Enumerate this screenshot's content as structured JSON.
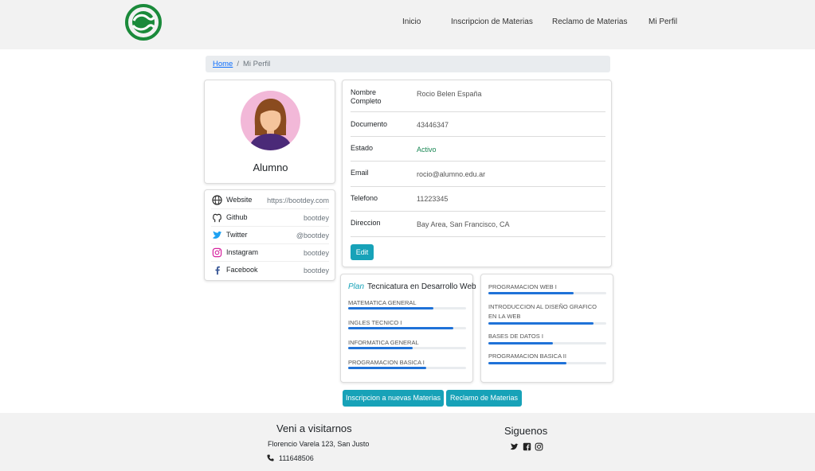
{
  "nav": {
    "logo_icon": "utn-logo-icon",
    "links": [
      "Inicio",
      "Inscripcion de Materias",
      "Reclamo de Materias",
      "Mi Perfil"
    ]
  },
  "breadcrumb": {
    "home": "Home",
    "current": "Mi Perfil"
  },
  "profile": {
    "role": "Alumno",
    "avatar_icon": "female-user-avatar"
  },
  "social": [
    {
      "icon": "globe-icon",
      "name": "Website",
      "value": "https://bootdey.com"
    },
    {
      "icon": "github-icon",
      "name": "Github",
      "value": "bootdey"
    },
    {
      "icon": "twitter-icon",
      "name": "Twitter",
      "value": "@bootdey"
    },
    {
      "icon": "instagram-icon",
      "name": "Instagram",
      "value": "bootdey"
    },
    {
      "icon": "facebook-icon",
      "name": "Facebook",
      "value": "bootdey"
    }
  ],
  "info": [
    {
      "label": "Nombre Completo",
      "value": "Rocio Belen España"
    },
    {
      "label": "Documento",
      "value": "43446347"
    },
    {
      "label": "Estado",
      "value": "Activo"
    },
    {
      "label": "Email",
      "value": "rocio@alumno.edu.ar"
    },
    {
      "label": "Telefono",
      "value": "11223345"
    },
    {
      "label": "Direccion",
      "value": "Bay Area, San Francisco, CA"
    }
  ],
  "edit_label": "Edit",
  "plan": {
    "plan_label": "Plan",
    "name": "Tecnicatura en Desarrollo Web",
    "left": [
      {
        "name": "MATEMATICA GENERAL",
        "progress": 72
      },
      {
        "name": "INGLES TECNICO I",
        "progress": 89
      },
      {
        "name": "INFORMATICA GENERAL",
        "progress": 55
      },
      {
        "name": "PROGRAMACION BASICA I",
        "progress": 66
      }
    ],
    "right": [
      {
        "name": "PROGRAMACION WEB I",
        "progress": 72
      },
      {
        "name": "INTRODUCCION AL DISEÑO GRAFICO EN LA WEB",
        "progress": 89
      },
      {
        "name": "BASES DE DATOS I",
        "progress": 55
      },
      {
        "name": "PROGRAMACION BASICA II",
        "progress": 66
      }
    ]
  },
  "actions": {
    "inscripcion": "Inscripcion a nuevas Materias",
    "reclamo": "Reclamo de Materias"
  },
  "colors": {
    "accent": "#17a2b8",
    "progress": "#1f72d8",
    "status_active": "#198754",
    "logo_green": "#1a8a3a"
  },
  "footer": {
    "visit_title": "Veni a visitarnos",
    "address": "Florencio Varela 123, San Justo",
    "phone_icon": "phone-icon",
    "phone": "111648506",
    "follow_title": "Siguenos",
    "follow_icons": [
      "twitter-icon",
      "facebook-square-icon",
      "instagram-icon"
    ]
  }
}
